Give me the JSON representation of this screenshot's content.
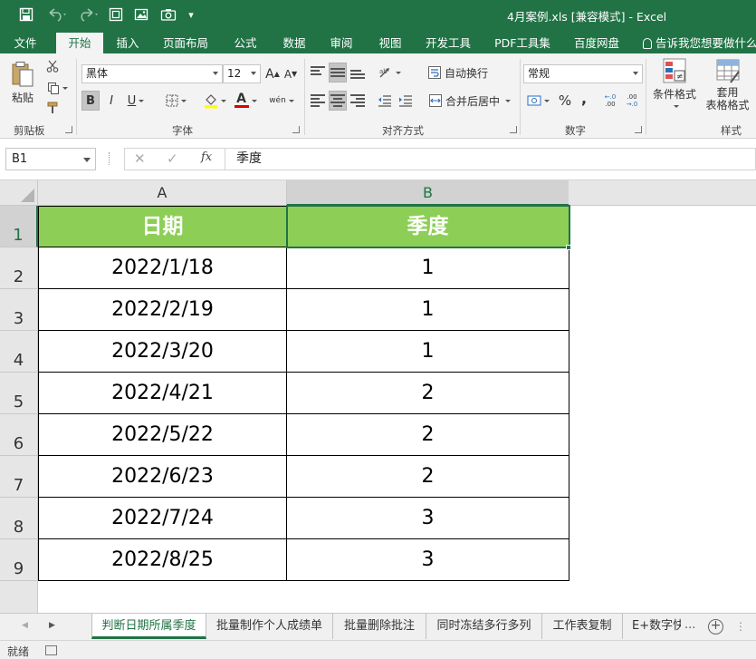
{
  "window": {
    "title": "4月案例.xls  [兼容模式] - Excel"
  },
  "quick_access": {
    "icons": [
      "save-icon",
      "undo-icon",
      "redo-icon",
      "screenshot-icon",
      "picture-icon",
      "camera-icon",
      "customize-icon"
    ],
    "customize_glyph": "▾"
  },
  "ribbon_tabs": [
    {
      "label": "文件"
    },
    {
      "label": "开始"
    },
    {
      "label": "插入"
    },
    {
      "label": "页面布局"
    },
    {
      "label": "公式"
    },
    {
      "label": "数据"
    },
    {
      "label": "审阅"
    },
    {
      "label": "视图"
    },
    {
      "label": "开发工具"
    },
    {
      "label": "PDF工具集"
    },
    {
      "label": "百度网盘"
    }
  ],
  "tell_me": "告诉我您想要做什么",
  "ribbon": {
    "clipboard": {
      "label": "剪贴板",
      "paste": "粘贴"
    },
    "font": {
      "label": "字体",
      "font_name": "黑体",
      "font_size": "12",
      "bold": "B",
      "italic": "I",
      "underline": "U",
      "grow": "A",
      "shrink": "A",
      "font_color_glyph": "A",
      "phonetic": "wén"
    },
    "alignment": {
      "label": "对齐方式",
      "wrap_text": "自动换行",
      "merge_center": "合并后居中"
    },
    "number": {
      "label": "数字",
      "format": "常规",
      "percent": "%",
      "comma": ",",
      "inc_decimal": "←.0\n.00",
      "dec_decimal": ".00\n→.0"
    },
    "styles": {
      "label": "样式",
      "conditional_format": "条件格式",
      "table_format_1": "套用",
      "table_format_2": "表格格式"
    }
  },
  "formula_bar": {
    "name_box": "B1",
    "cancel": "✕",
    "enter": "✓",
    "fx": "fx",
    "content": "季度"
  },
  "sheet": {
    "columns": [
      "A",
      "B"
    ],
    "rows": [
      "1",
      "2",
      "3",
      "4",
      "5",
      "6",
      "7",
      "8",
      "9"
    ],
    "header": [
      "日期",
      "季度"
    ],
    "data": [
      [
        "2022/1/18",
        "1"
      ],
      [
        "2022/2/19",
        "1"
      ],
      [
        "2022/3/20",
        "1"
      ],
      [
        "2022/4/21",
        "2"
      ],
      [
        "2022/5/22",
        "2"
      ],
      [
        "2022/6/23",
        "2"
      ],
      [
        "2022/7/24",
        "3"
      ],
      [
        "2022/8/25",
        "3"
      ]
    ],
    "selected_cell": "B1"
  },
  "sheet_tabs": [
    {
      "label": "判断日期所属季度",
      "active": true
    },
    {
      "label": "批量制作个人成绩单"
    },
    {
      "label": "批量删除批注"
    },
    {
      "label": "同时冻结多行多列"
    },
    {
      "label": "工作表复制"
    },
    {
      "label": "E+数字快..."
    }
  ],
  "sheet_tab_ellipsis": "...",
  "add_sheet": "+",
  "status": {
    "text": "就绪"
  },
  "colors": {
    "excel_green": "#217346",
    "header_fill": "#8dce57",
    "header_text": "#ffffff"
  }
}
